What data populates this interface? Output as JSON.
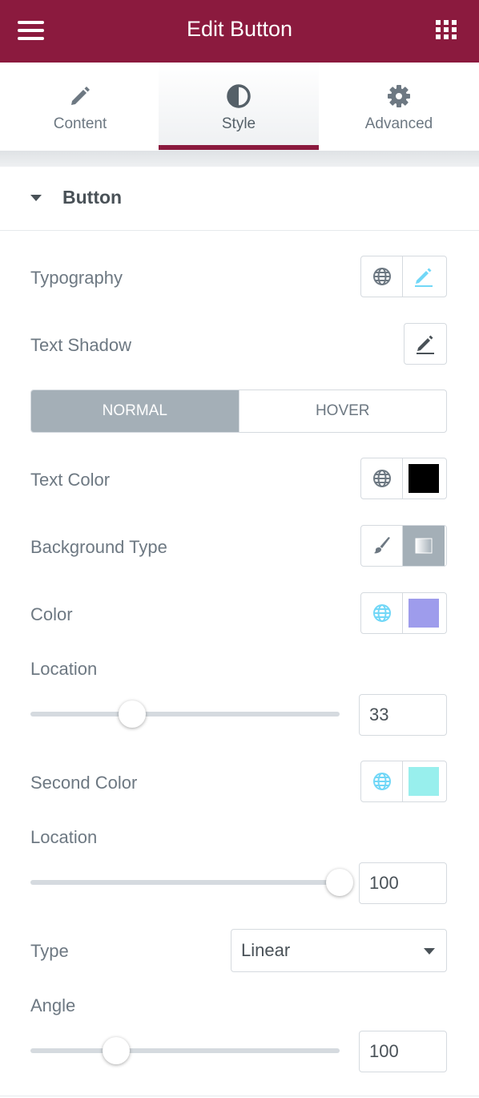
{
  "header": {
    "title": "Edit Button",
    "menu_icon": "hamburger-menu-icon",
    "apps_icon": "grid-apps-icon",
    "background_color": "#8b1a3e"
  },
  "tabs": [
    {
      "label": "Content",
      "icon": "pencil-icon",
      "active": false
    },
    {
      "label": "Style",
      "icon": "half-circle-contrast-icon",
      "active": true
    },
    {
      "label": "Advanced",
      "icon": "gear-icon",
      "active": false
    }
  ],
  "section": {
    "title": "Button",
    "expanded": true
  },
  "controls": {
    "typography_label": "Typography",
    "text_shadow_label": "Text Shadow",
    "state_toggle": {
      "options": [
        "NORMAL",
        "HOVER"
      ],
      "active": "NORMAL"
    },
    "text_color": {
      "label": "Text Color",
      "value": "#000000"
    },
    "background_type": {
      "label": "Background Type",
      "options": [
        "classic",
        "gradient"
      ],
      "active": "gradient"
    },
    "color": {
      "label": "Color",
      "value": "#9e9cec"
    },
    "location": {
      "label": "Location",
      "value": "33",
      "fraction": 0.33
    },
    "second_color": {
      "label": "Second Color",
      "value": "#98efed"
    },
    "second_location": {
      "label": "Location",
      "value": "100",
      "fraction": 1.0
    },
    "type": {
      "label": "Type",
      "value": "Linear"
    },
    "angle": {
      "label": "Angle",
      "value": "100",
      "fraction": 0.278
    }
  }
}
